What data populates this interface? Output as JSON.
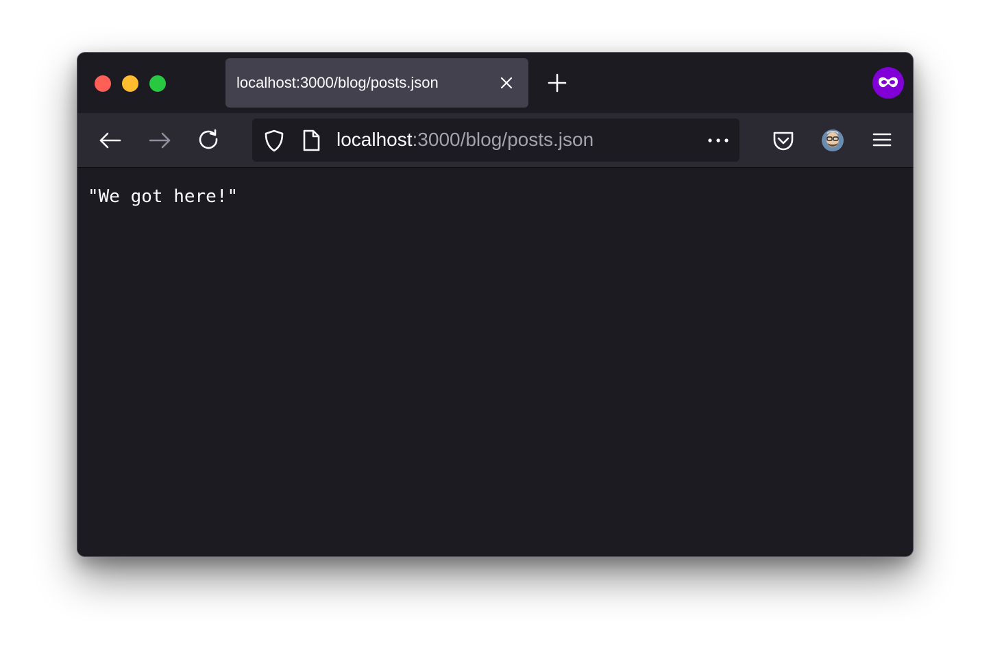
{
  "window": {
    "traffic_lights": {
      "close_color": "#ff5f57",
      "minimize_color": "#febc2e",
      "maximize_color": "#28c840"
    }
  },
  "tab": {
    "title": "localhost:3000/blog/posts.json",
    "close_icon": "close-icon"
  },
  "tabbar": {
    "new_tab_icon": "plus-icon",
    "private_icon": "private-browsing-mask-icon",
    "private_color": "#8000d7"
  },
  "navbar": {
    "back_icon": "arrow-left-icon",
    "forward_icon": "arrow-right-icon",
    "reload_icon": "reload-icon",
    "url": {
      "host": "localhost",
      "rest": ":3000/blog/posts.json"
    },
    "shield_icon": "shield-icon",
    "page_icon": "page-icon",
    "more_icon": "more-dots-icon",
    "pocket_icon": "pocket-icon",
    "account_icon": "avatar",
    "menu_icon": "hamburger-menu-icon"
  },
  "content": {
    "text": "\"We got here!\""
  }
}
